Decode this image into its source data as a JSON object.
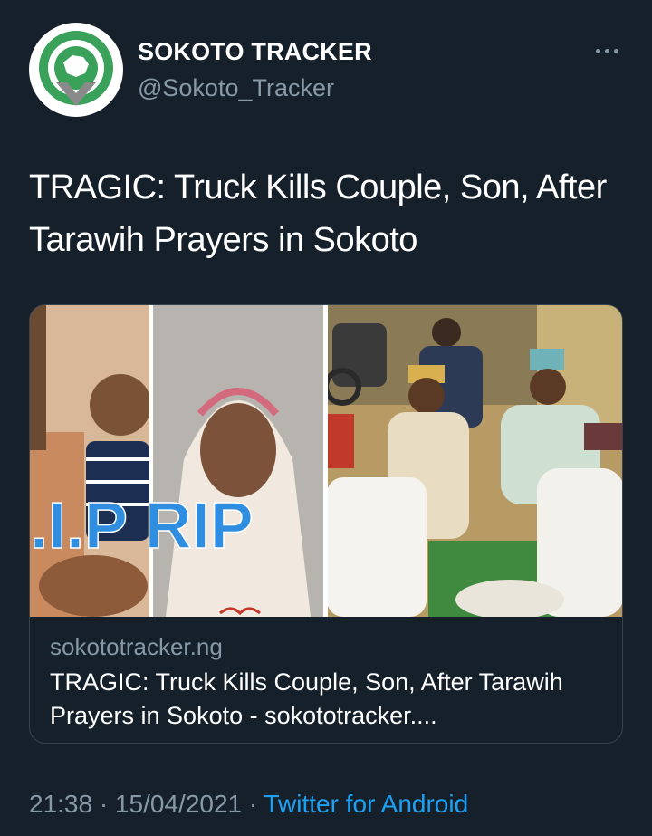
{
  "author": {
    "name": "SOKOTO TRACKER",
    "handle": "@Sokoto_Tracker"
  },
  "tweet": {
    "text": "TRAGIC: Truck Kills Couple, Son, After Tarawih Prayers in Sokoto"
  },
  "card": {
    "image_overlay_text": ".I.P RIP",
    "domain": "sokototracker.ng",
    "title": "TRAGIC: Truck Kills Couple, Son, After Tarawih Prayers in Sokoto - sokototracker...."
  },
  "meta": {
    "time": "21:38",
    "separator": "·",
    "date": "15/04/2021",
    "source": "Twitter for Android"
  },
  "colors": {
    "background": "#15202b",
    "secondary_text": "#8899a6",
    "link": "#1da1f2",
    "logo_green": "#3aa15a"
  },
  "icons": [
    "sokoto-tracker-logo",
    "more-options-icon"
  ]
}
